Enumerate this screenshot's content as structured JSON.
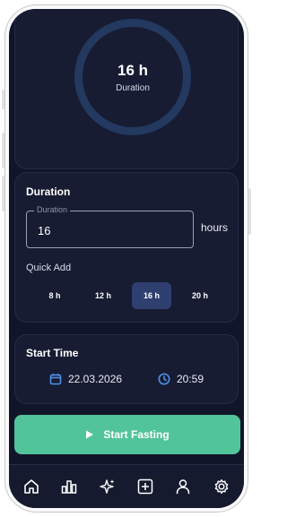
{
  "progress": {
    "value": "16 h",
    "label": "Duration"
  },
  "duration": {
    "title": "Duration",
    "field_legend": "Duration",
    "field_value": "16",
    "unit": "hours",
    "quick_add_label": "Quick Add",
    "quick_add_options": [
      "8 h",
      "12 h",
      "16 h",
      "20 h"
    ],
    "selected_option": "16 h"
  },
  "start_time": {
    "title": "Start Time",
    "date": "22.03.2026",
    "time": "20:59"
  },
  "start_button": {
    "label": "Start Fasting"
  },
  "nav": {
    "items": [
      "home-icon",
      "stats-icon",
      "sparkle-icon",
      "add-icon",
      "profile-icon",
      "settings-icon"
    ]
  },
  "colors": {
    "background": "#11152a",
    "card": "#171c33",
    "accent": "#52c49a",
    "chip_active": "#2f3f70",
    "icon_blue": "#4f8fe6",
    "ring": "#23395f"
  }
}
